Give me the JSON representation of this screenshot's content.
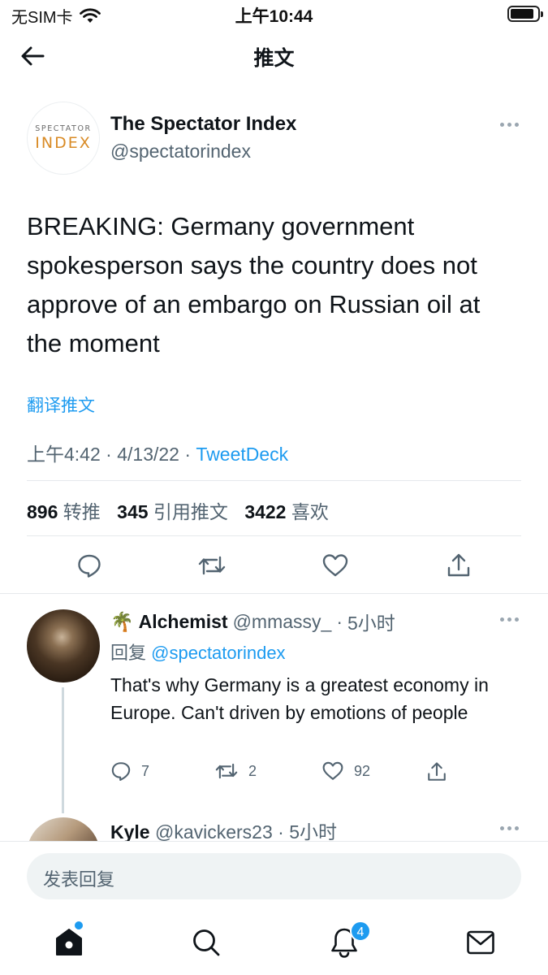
{
  "status_bar": {
    "carrier": "无SIM卡",
    "time": "上午10:44"
  },
  "nav": {
    "title": "推文"
  },
  "tweet": {
    "author_name": "The Spectator Index",
    "author_handle": "@spectatorindex",
    "logo_top": "SPECTATOR",
    "logo_bottom": "INDEX",
    "text": "BREAKING: Germany government spokesperson says the country does not approve of an embargo on Russian oil at the moment",
    "translate": "翻译推文",
    "time": "上午4:42",
    "date": "4/13/22",
    "source": "TweetDeck",
    "stats": {
      "retweets": "896",
      "retweets_label": "转推",
      "quotes": "345",
      "quotes_label": "引用推文",
      "likes": "3422",
      "likes_label": "喜欢"
    }
  },
  "replies": [
    {
      "emoji": "🌴",
      "name": "Alchemist",
      "handle": "@mmassy_",
      "time": "5小时",
      "reply_prefix": "回复",
      "reply_to": "@spectatorindex",
      "text": "That's why Germany is a greatest economy in Europe. Can't driven by emotions of people",
      "replies_count": "7",
      "retweets_count": "2",
      "likes_count": "92"
    },
    {
      "name": "Kyle",
      "handle": "@kavickers23",
      "time": "5小时"
    }
  ],
  "composer": {
    "placeholder": "发表回复"
  },
  "tabbar": {
    "notifications_badge": "4"
  },
  "colors": {
    "accent": "#1d9bf0",
    "muted": "#536471",
    "text": "#0f1419"
  }
}
